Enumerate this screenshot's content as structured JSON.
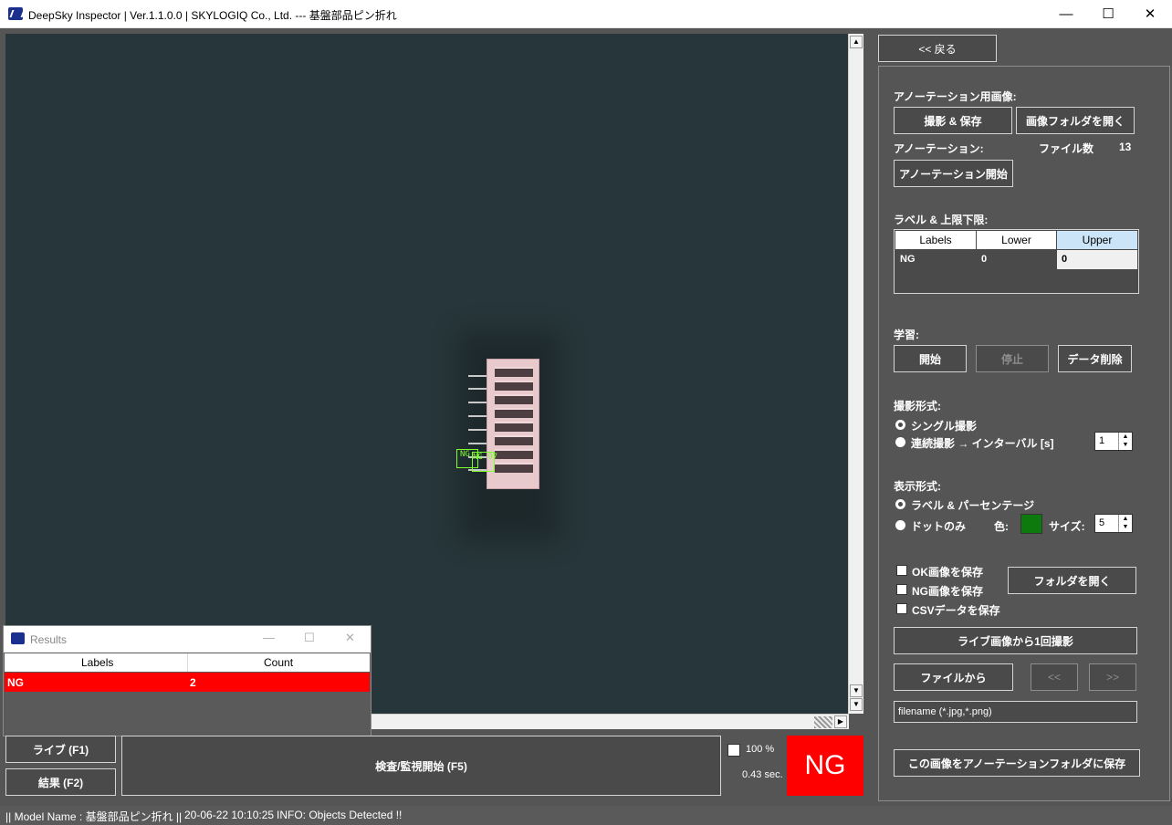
{
  "window": {
    "title": "DeepSky Inspector | Ver.1.1.0.0 | SKYLOGIQ Co., Ltd. --- 基盤部品ピン折れ",
    "minimize": "—",
    "maximize": "☐",
    "close": "✕"
  },
  "viewer": {
    "detection_labels": [
      "NG",
      "NG 97"
    ],
    "scroll_up": "▲",
    "scroll_down": "▼",
    "scroll_left": "◀",
    "scroll_right": "▶"
  },
  "results_window": {
    "title": "Results",
    "columns": [
      "Labels",
      "Count"
    ],
    "rows": [
      {
        "label": "NG",
        "count": "2"
      }
    ]
  },
  "bottom": {
    "live_button": "ライブ (F1)",
    "results_button": "結果 (F2)",
    "inspect_button": "検査/監視開始 (F5)",
    "zoom_label": "100 %",
    "elapsed": "0.43 sec.",
    "verdict": "NG"
  },
  "panel": {
    "back_button": "<< 戻る",
    "annotation_image_heading": "アノーテーション用画像:",
    "capture_save_button": "撮影 & 保存",
    "open_image_folder_button": "画像フォルダを開く",
    "annotation_heading": "アノーテーション:",
    "file_count_label": "ファイル数",
    "file_count_value": "13",
    "start_annotation_button": "アノーテーション開始",
    "label_limits_heading": "ラベル & 上限下限:",
    "grid_columns": [
      "Labels",
      "Lower",
      "Upper"
    ],
    "grid_rows": [
      {
        "label": "NG",
        "lower": "0",
        "upper": "0"
      }
    ],
    "training_heading": "学習:",
    "train_start_button": "開始",
    "train_stop_button": "停止",
    "delete_data_button": "データ削除",
    "capture_mode_heading": "撮影形式:",
    "single_capture": "シングル撮影",
    "continuous_capture": "連続撮影 → インターバル [s]",
    "interval_value": "1",
    "display_mode_heading": "表示形式:",
    "label_percentage": "ラベル & パーセンテージ",
    "dots_only": "ドットのみ",
    "color_label": "色:",
    "dot_color": "#0c7a0c",
    "size_label": "サイズ:",
    "size_value": "5",
    "save_ok_images": "OK画像を保存",
    "save_ng_images": "NG画像を保存",
    "save_csv": "CSVデータを保存",
    "open_folder_button": "フォルダを開く",
    "capture_once_button": "ライブ画像から1回撮影",
    "from_file_button": "ファイルから",
    "prev_button": "<<",
    "next_button": ">>",
    "filename_placeholder": "filename (*.jpg,*.png)",
    "save_to_annotation_button": "この画像をアノーテーションフォルダに保存"
  },
  "status": {
    "model": "|| Model Name : 基盤部品ピン折れ ||",
    "timestamp": "20-06-22 10:10:25",
    "info": "INFO:   Objects Detected !!"
  }
}
